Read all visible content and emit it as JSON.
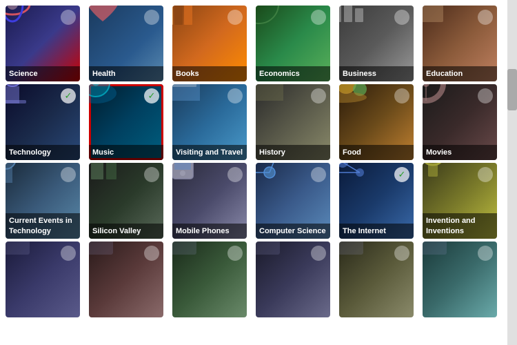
{
  "categories": [
    {
      "id": "science",
      "label": "Science",
      "bg": "bg-science",
      "checked": false,
      "row": 1
    },
    {
      "id": "health",
      "label": "Health",
      "bg": "bg-health",
      "checked": false,
      "row": 1
    },
    {
      "id": "books",
      "label": "Books",
      "bg": "bg-books",
      "checked": false,
      "row": 1
    },
    {
      "id": "economics",
      "label": "Economics",
      "bg": "bg-economics",
      "checked": false,
      "row": 1
    },
    {
      "id": "business",
      "label": "Business",
      "bg": "bg-business",
      "checked": false,
      "row": 1
    },
    {
      "id": "education",
      "label": "Education",
      "bg": "bg-education",
      "checked": false,
      "row": 1
    },
    {
      "id": "technology",
      "label": "Technology",
      "bg": "bg-technology",
      "checked": true,
      "row": 2
    },
    {
      "id": "music",
      "label": "Music",
      "bg": "bg-music",
      "checked": true,
      "selected": true,
      "row": 2
    },
    {
      "id": "visiting",
      "label": "Visiting and Travel",
      "bg": "bg-visiting",
      "checked": false,
      "row": 2
    },
    {
      "id": "history",
      "label": "History",
      "bg": "bg-history",
      "checked": false,
      "row": 2
    },
    {
      "id": "food",
      "label": "Food",
      "bg": "bg-food",
      "checked": false,
      "row": 2
    },
    {
      "id": "movies",
      "label": "Movies",
      "bg": "bg-movies",
      "checked": false,
      "row": 2
    },
    {
      "id": "currentevents",
      "label": "Current Events in Technology",
      "bg": "bg-currentevents",
      "checked": false,
      "row": 3
    },
    {
      "id": "siliconvalley",
      "label": "Silicon Valley",
      "bg": "bg-siliconvalley",
      "checked": false,
      "row": 3
    },
    {
      "id": "mobilephones",
      "label": "Mobile Phones",
      "bg": "bg-mobilephones",
      "checked": false,
      "row": 3
    },
    {
      "id": "computerscience",
      "label": "Computer Science",
      "bg": "bg-computerscience",
      "checked": false,
      "row": 3
    },
    {
      "id": "internet",
      "label": "The Internet",
      "bg": "bg-internet",
      "checked": true,
      "row": 3
    },
    {
      "id": "invention",
      "label": "Invention and Inventions",
      "bg": "bg-invention",
      "checked": false,
      "row": 3
    },
    {
      "id": "row4a",
      "label": "",
      "bg": "bg-row4a",
      "checked": false,
      "row": 4
    },
    {
      "id": "row4b",
      "label": "",
      "bg": "bg-row4b",
      "checked": false,
      "row": 4
    },
    {
      "id": "row4c",
      "label": "",
      "bg": "bg-row4c",
      "checked": false,
      "row": 4
    },
    {
      "id": "row4d",
      "label": "",
      "bg": "bg-row4d",
      "checked": false,
      "row": 4
    },
    {
      "id": "row4e",
      "label": "",
      "bg": "bg-row4e",
      "checked": false,
      "row": 4
    },
    {
      "id": "row4f",
      "label": "",
      "bg": "bg-row4f",
      "checked": false,
      "row": 4
    }
  ],
  "scrollbar": {
    "visible": true
  }
}
